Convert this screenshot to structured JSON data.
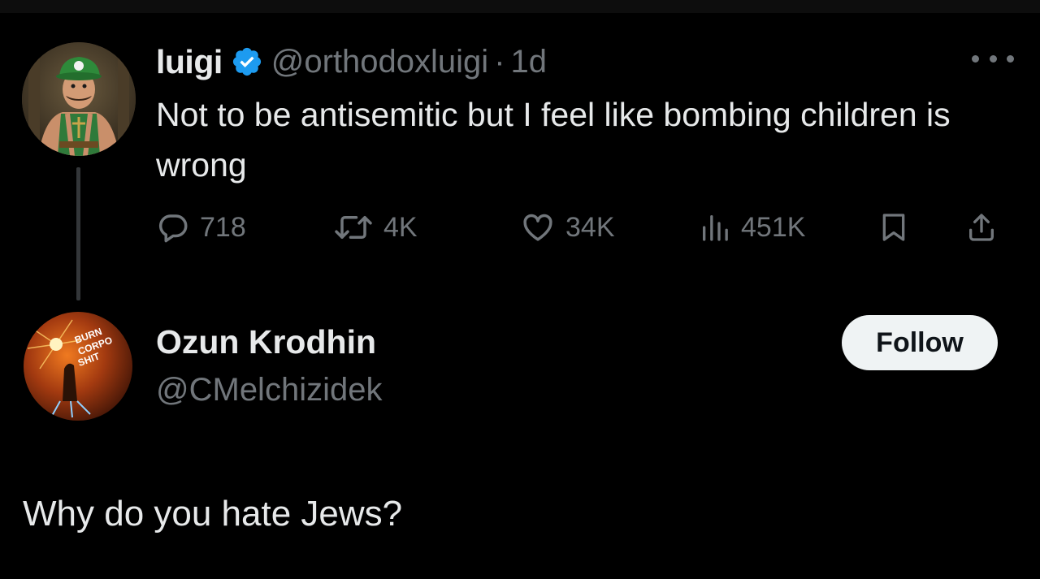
{
  "parent_tweet": {
    "name": "luigi",
    "handle": "@orthodoxluigi",
    "separator": "·",
    "time": "1d",
    "text": "Not to be antisemitic but I feel like bombing children is wrong",
    "verified": true,
    "avatar_icon": "luigi-avatar",
    "stats": {
      "replies": "718",
      "reposts": "4K",
      "likes": "34K",
      "views": "451K"
    }
  },
  "reply": {
    "name": "Ozun Krodhin",
    "handle": "@CMelchizidek",
    "follow_label": "Follow",
    "text": "Why do you hate Jews?",
    "avatar_icon": "ozun-avatar",
    "avatar_text": "BURN CORPO SHIT"
  },
  "colors": {
    "background": "#000000",
    "text": "#e7e9ea",
    "muted": "#71767b",
    "verified": "#1d9bf0",
    "follow_bg": "#eff3f4"
  }
}
